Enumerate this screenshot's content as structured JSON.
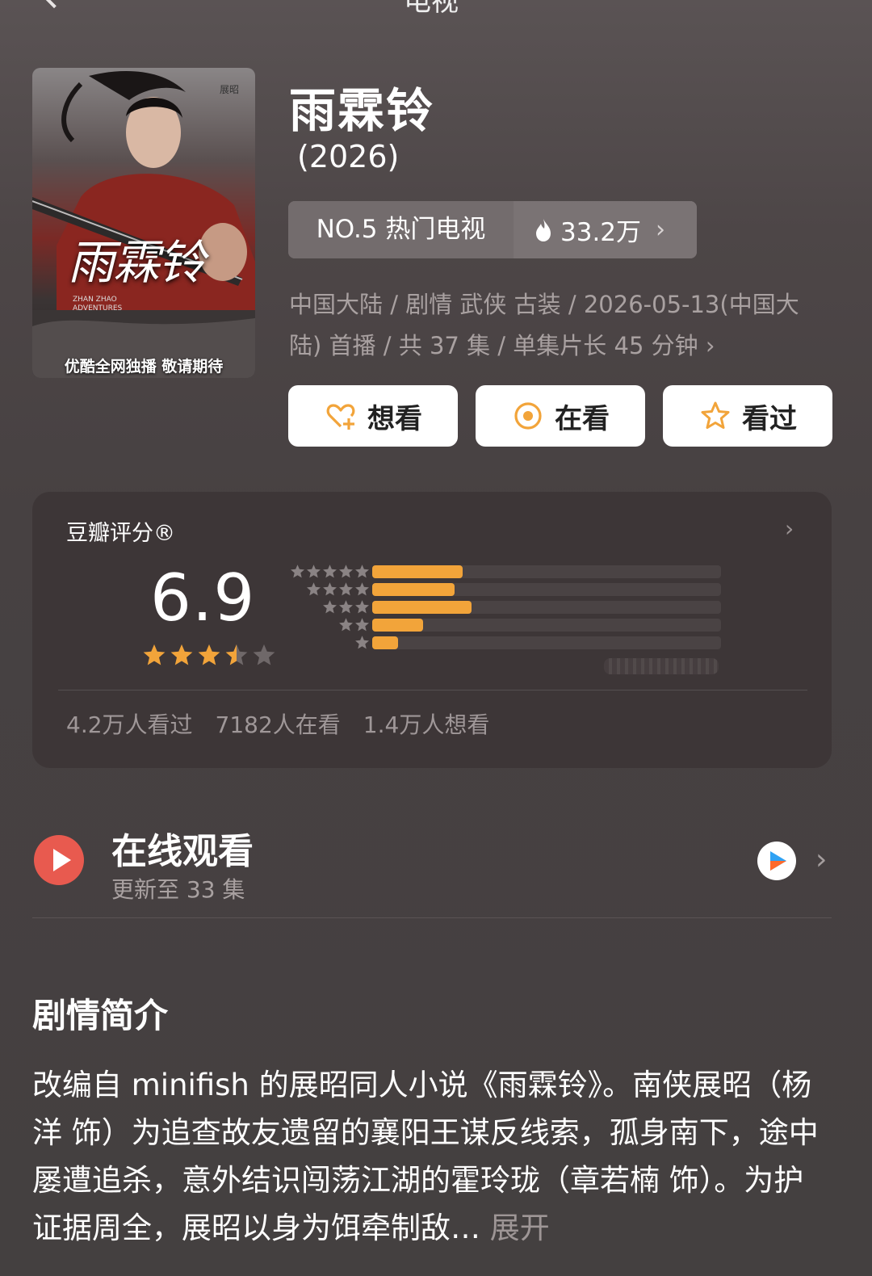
{
  "nav": {
    "title": "电视"
  },
  "poster": {
    "title_art": "雨霖铃",
    "corner_name": "展昭",
    "english_sub": "ZHAN ZHAO ADVENTURES",
    "tagline": "优酷全网独播 敬请期待"
  },
  "show": {
    "title": "雨霖铃",
    "year": "(2026)",
    "rank_label": "NO.5 热门电视",
    "heat": "33.2万",
    "meta": "中国大陆 / 剧情 武侠 古装 / 2026-05-13(中国大陆) 首播 / 共 37 集 / 单集片长 45 分钟"
  },
  "actions": {
    "want": "想看",
    "watching": "在看",
    "watched": "看过"
  },
  "rating": {
    "label": "豆瓣评分®",
    "score": "6.9",
    "star_value": 3.5,
    "distribution": [
      {
        "stars": 5,
        "fraction": 0.26
      },
      {
        "stars": 4,
        "fraction": 0.235
      },
      {
        "stars": 3,
        "fraction": 0.285
      },
      {
        "stars": 2,
        "fraction": 0.145
      },
      {
        "stars": 1,
        "fraction": 0.075
      }
    ],
    "stats": [
      "4.2万人看过",
      "7182人在看",
      "1.4万人想看"
    ]
  },
  "watch": {
    "title": "在线观看",
    "subtitle": "更新至 33 集",
    "provider_icon": "youku-icon"
  },
  "synopsis": {
    "heading": "剧情简介",
    "text": "改编自 minifish 的展昭同人小说《雨霖铃》。南侠展昭（杨洋 饰）为追查故友遗留的襄阳王谋反线索，孤身南下，途中屡遭追杀，意外结识闯荡江湖的霍玲珑（章若楠 饰）。为护证据周全，展昭以身为饵牵制敌…",
    "more": "展开"
  },
  "colors": {
    "accent": "#f2a43a",
    "play_red": "#e85a4f",
    "background": "#4a4445"
  }
}
